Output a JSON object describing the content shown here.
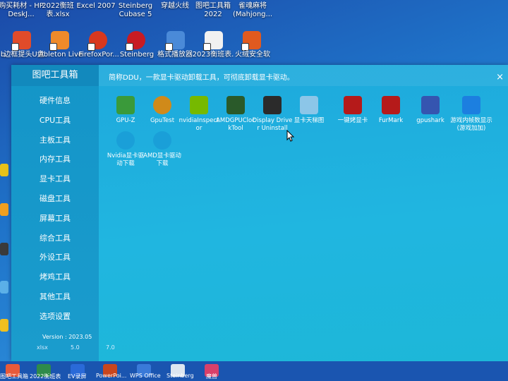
{
  "desktop": {
    "top_labels": [
      "购买耗材 - HP DeskJ...",
      "2022衡班表.xlsx",
      "Excel 2007",
      "Steinberg Cubase 5",
      "穿越火线",
      "图吧工具箱2022",
      "雀魂麻将(Mahjong..."
    ],
    "icon_labels": [
      "b",
      "边框提头U盘",
      "Ableton Live",
      "FirefoxPor...",
      "Steinberg",
      "格式播放器",
      "2023衡班表.",
      "火绒安全软"
    ],
    "under_labels": [
      "xlsx",
      "5.0",
      "7.0"
    ]
  },
  "app": {
    "sidebar": {
      "title": "图吧工具箱",
      "items": [
        "硬件信息",
        "CPU工具",
        "主板工具",
        "内存工具",
        "显卡工具",
        "磁盘工具",
        "屏幕工具",
        "综合工具",
        "外设工具",
        "烤鸡工具",
        "其他工具",
        "选项设置"
      ],
      "version": "Version : 2023.05"
    },
    "notice": "简称DDU，一款显卡驱动卸载工具，可彻底卸载显卡驱动。",
    "close_label": "×",
    "tools": [
      {
        "label": "GPU-Z",
        "icon": "gpu-z-icon",
        "color": "#3a9a3a"
      },
      {
        "label": "GpuTest",
        "icon": "gputest-icon",
        "color": "#d08a1a"
      },
      {
        "label": "nvidiaInspector",
        "icon": "nvidia-inspector-icon",
        "color": "#76b900"
      },
      {
        "label": "AMDGPUClockTool",
        "icon": "amd-clock-icon",
        "color": "#2a5a2a"
      },
      {
        "label": "Display Driver Uninstall",
        "icon": "ddu-icon",
        "color": "#2b2b2b"
      },
      {
        "label": "显卡天梯图",
        "icon": "gpu-ladder-icon",
        "color": "#8cc6e8"
      },
      {
        "label": "一键烤显卡",
        "icon": "burn-gpu-icon",
        "color": "#b51a1a"
      },
      {
        "label": "FurMark",
        "icon": "furmark-icon",
        "color": "#b51a1a"
      },
      {
        "label": "gpushark",
        "icon": "gpushark-icon",
        "color": "#3555b0"
      },
      {
        "label": "游戏内帧数显示(游戏加加)",
        "icon": "game-plus-icon",
        "color": "#1c7fe0"
      },
      {
        "label": "Nvidia显卡驱动下载",
        "icon": "edge-icon",
        "color": "#1a9fd8"
      },
      {
        "label": "AMD显卡驱动下载",
        "icon": "edge-icon",
        "color": "#1a9fd8"
      }
    ]
  },
  "taskbar": {
    "labels": [
      "图吧工具箱",
      "2022衡班表",
      "EV录屏",
      "PowerPoi...",
      "WPS Office",
      "Steinberg",
      "魔兽"
    ]
  }
}
